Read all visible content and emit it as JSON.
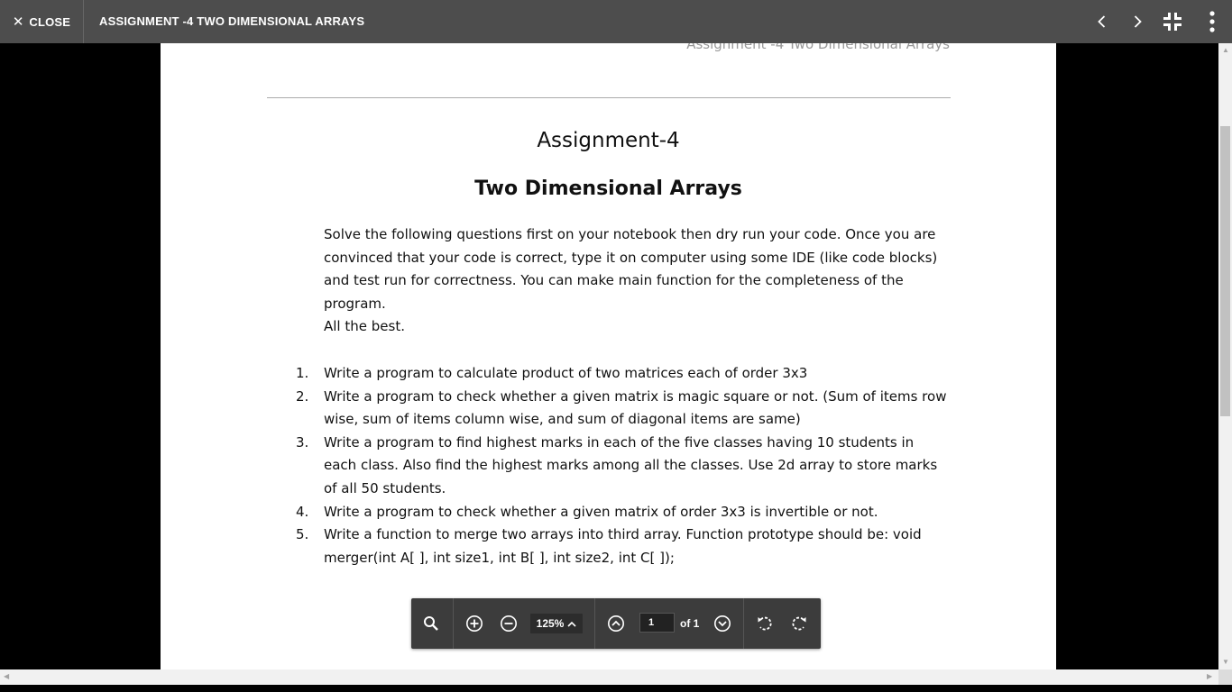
{
  "topbar": {
    "close_label": "CLOSE",
    "title": "ASSIGNMENT -4 TWO DIMENSIONAL ARRAYS"
  },
  "document": {
    "running_header": "Assignment -4 Two Dimensional Arrays",
    "heading": "Assignment-4",
    "subheading": "Two Dimensional Arrays",
    "intro_paragraph": "Solve the following questions first on your notebook then dry run your code. Once you are convinced that your code is correct, type it on computer using some IDE (like code blocks) and test run for correctness. You can make main function for the completeness of the program.",
    "intro_closing": "All the best.",
    "questions": [
      {
        "num": "1.",
        "text": "Write a program to calculate product of two matrices each of order 3x3"
      },
      {
        "num": "2.",
        "text": "Write a program to check whether a given matrix is magic square or not. (Sum of items row wise, sum of items column wise, and sum of diagonal items are same)"
      },
      {
        "num": "3.",
        "text": "Write a program to find highest marks in each of the five classes having 10 students in each class. Also find the highest marks among all the classes. Use 2d array to store marks of all 50 students."
      },
      {
        "num": "4.",
        "text": "Write a program to check whether a given matrix of order 3x3 is invertible or not."
      },
      {
        "num": "5.",
        "text": "Write a function to merge two arrays into third array. Function prototype should be: void merger(int A[ ], int size1, int B[ ], int size2, int C[ ]);"
      }
    ]
  },
  "viewer": {
    "zoom": "125%",
    "page_number": "1",
    "page_total_label": "of 1"
  },
  "icons": {
    "close": "close-icon",
    "prev": "chevron-left-icon",
    "next": "chevron-right-icon",
    "exit_fullscreen": "exit-fullscreen-icon",
    "more": "more-vert-icon",
    "search": "search-icon",
    "zoom_in": "zoom-in-icon",
    "zoom_out": "zoom-out-icon",
    "prev_page": "page-up-icon",
    "next_page": "page-down-icon",
    "rotate_ccw": "rotate-left-icon",
    "rotate_cw": "rotate-right-icon"
  },
  "colors": {
    "topbar_bg": "#4d4d4d",
    "toolbar_bg": "#3c3c3c",
    "page_bg": "#ffffff",
    "viewer_bg": "#000000"
  }
}
